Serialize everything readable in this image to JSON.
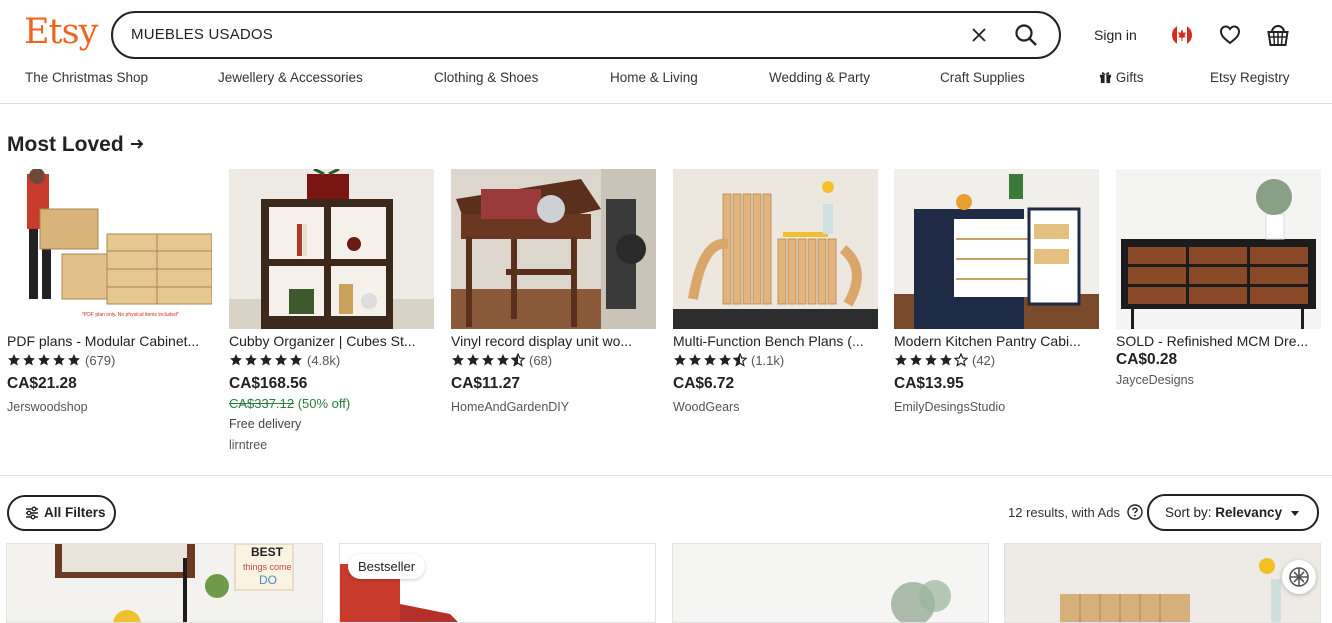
{
  "header": {
    "logo": "Etsy",
    "search_value": "MUEBLES USADOS",
    "sign_in": "Sign in"
  },
  "nav": [
    "The Christmas Shop",
    "Jewellery & Accessories",
    "Clothing & Shoes",
    "Home & Living",
    "Wedding & Party",
    "Craft Supplies",
    "Gifts",
    "Etsy Registry"
  ],
  "most_loved": {
    "title": "Most Loved",
    "items": [
      {
        "title": "PDF plans - Modular Cabinet...",
        "rating": 5,
        "count": "(679)",
        "price": "CA$21.28",
        "shop": "Jerswoodshop"
      },
      {
        "title": "Cubby Organizer | Cubes St...",
        "rating": 5,
        "count": "(4.8k)",
        "price": "CA$168.56",
        "orig_price": "CA$337.12",
        "discount": "(50% off)",
        "free_delivery": "Free delivery",
        "shop": "lirntree"
      },
      {
        "title": "Vinyl record display unit wo...",
        "rating": 4.5,
        "count": "(68)",
        "price": "CA$11.27",
        "shop": "HomeAndGardenDIY"
      },
      {
        "title": "Multi-Function Bench Plans (...",
        "rating": 4.5,
        "count": "(1.1k)",
        "price": "CA$6.72",
        "shop": "WoodGears"
      },
      {
        "title": "Modern Kitchen Pantry Cabi...",
        "rating": 4,
        "count": "(42)",
        "price": "CA$13.95",
        "shop": "EmilyDesingsStudio"
      },
      {
        "title": "SOLD - Refinished MCM Dre...",
        "price": "CA$0.28",
        "shop": "JayceDesigns"
      }
    ]
  },
  "filters": {
    "all_filters": "All Filters",
    "results": "12 results, with Ads",
    "sort_label": "Sort by: ",
    "sort_value": "Relevancy"
  },
  "results": {
    "badge": "Bestseller"
  },
  "colors": {
    "brand": "#f1641e",
    "discount": "#2a7d3c"
  }
}
